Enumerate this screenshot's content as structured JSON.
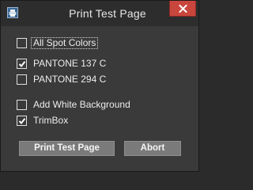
{
  "window": {
    "title": "Print Test Page"
  },
  "options": {
    "all_spot_colors": {
      "label": "All Spot Colors",
      "checked": false
    },
    "pantone_137": {
      "label": "PANTONE 137 C",
      "checked": true
    },
    "pantone_294": {
      "label": "PANTONE 294 C",
      "checked": false
    },
    "add_white_background": {
      "label": "Add White Background",
      "checked": false
    },
    "trimbox": {
      "label": "TrimBox",
      "checked": true
    }
  },
  "buttons": {
    "print_label": "Print Test Page",
    "abort_label": "Abort"
  },
  "colors": {
    "window_bg": "#2d2d2d",
    "content_bg": "#3a3a3a",
    "close_button": "#c9463d",
    "button_bg": "#7a7a7a",
    "text": "#ececec"
  },
  "icons": {
    "app": "print-icon",
    "close": "close-icon",
    "check": "checkmark-icon"
  }
}
